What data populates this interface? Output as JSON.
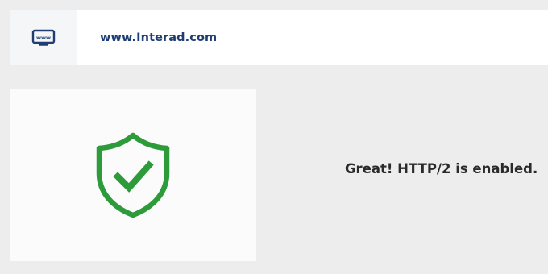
{
  "header": {
    "icon": "www-icon",
    "url": "www.Interad.com",
    "icon_label": "www"
  },
  "result": {
    "icon": "shield-check-icon",
    "message": "Great! HTTP/2 is enabled.",
    "status_color": "#2e9b3a"
  },
  "colors": {
    "accent": "#1f3d73",
    "background": "#ededee"
  }
}
